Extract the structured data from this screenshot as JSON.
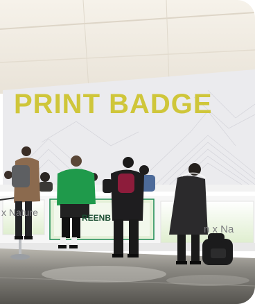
{
  "photo": {
    "sign_text": "PRINT BADGE",
    "counter_text_left": "x Nature",
    "counter_text_center": "REENB",
    "counter_text_right": "n x Na",
    "colors": {
      "sign_text": "#cfc63a",
      "backdrop": "#e9e9ec",
      "ceiling": "#eee9e1",
      "floor": "#6d6a63",
      "counter": "#f4f4f4",
      "counter_glow": "#d8ecc8",
      "accent_green": "#1b8a52"
    }
  }
}
